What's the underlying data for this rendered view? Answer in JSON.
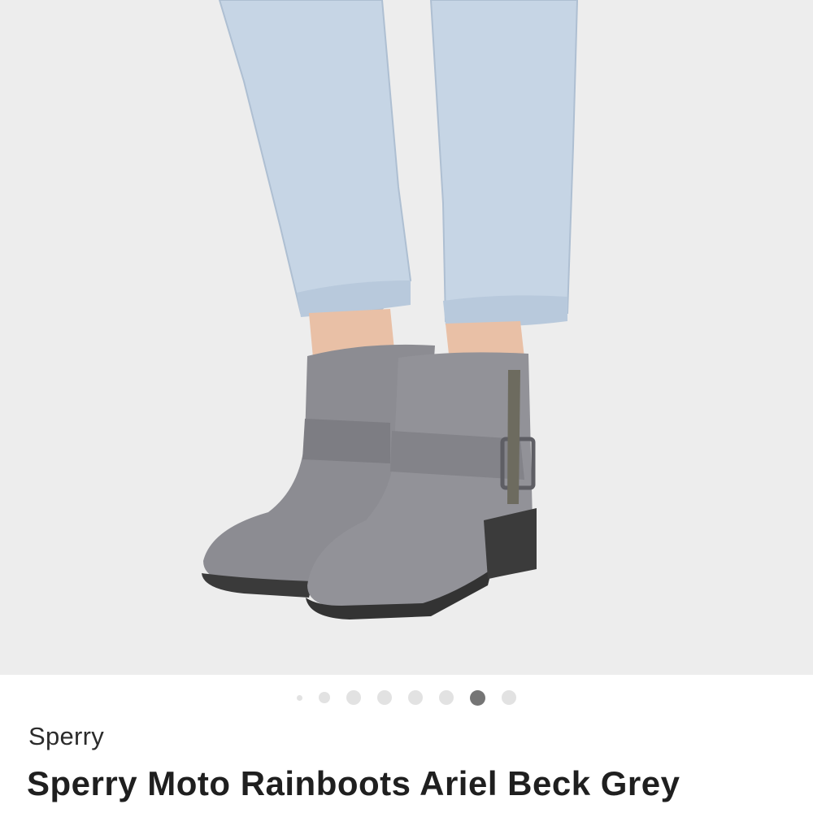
{
  "product": {
    "image_description_icon": "product-photo-grey-ankle-rainboots",
    "carousel": {
      "total": 8,
      "active_index": 6
    },
    "brand": "Sperry",
    "title": "Sperry Moto Rainboots Ariel Beck Grey"
  },
  "colors": {
    "background": "#ededed",
    "dot_inactive": "#e2e2e2",
    "dot_active": "#757575",
    "boot": "#8a8a90",
    "jeans": "#c3d2e2"
  }
}
